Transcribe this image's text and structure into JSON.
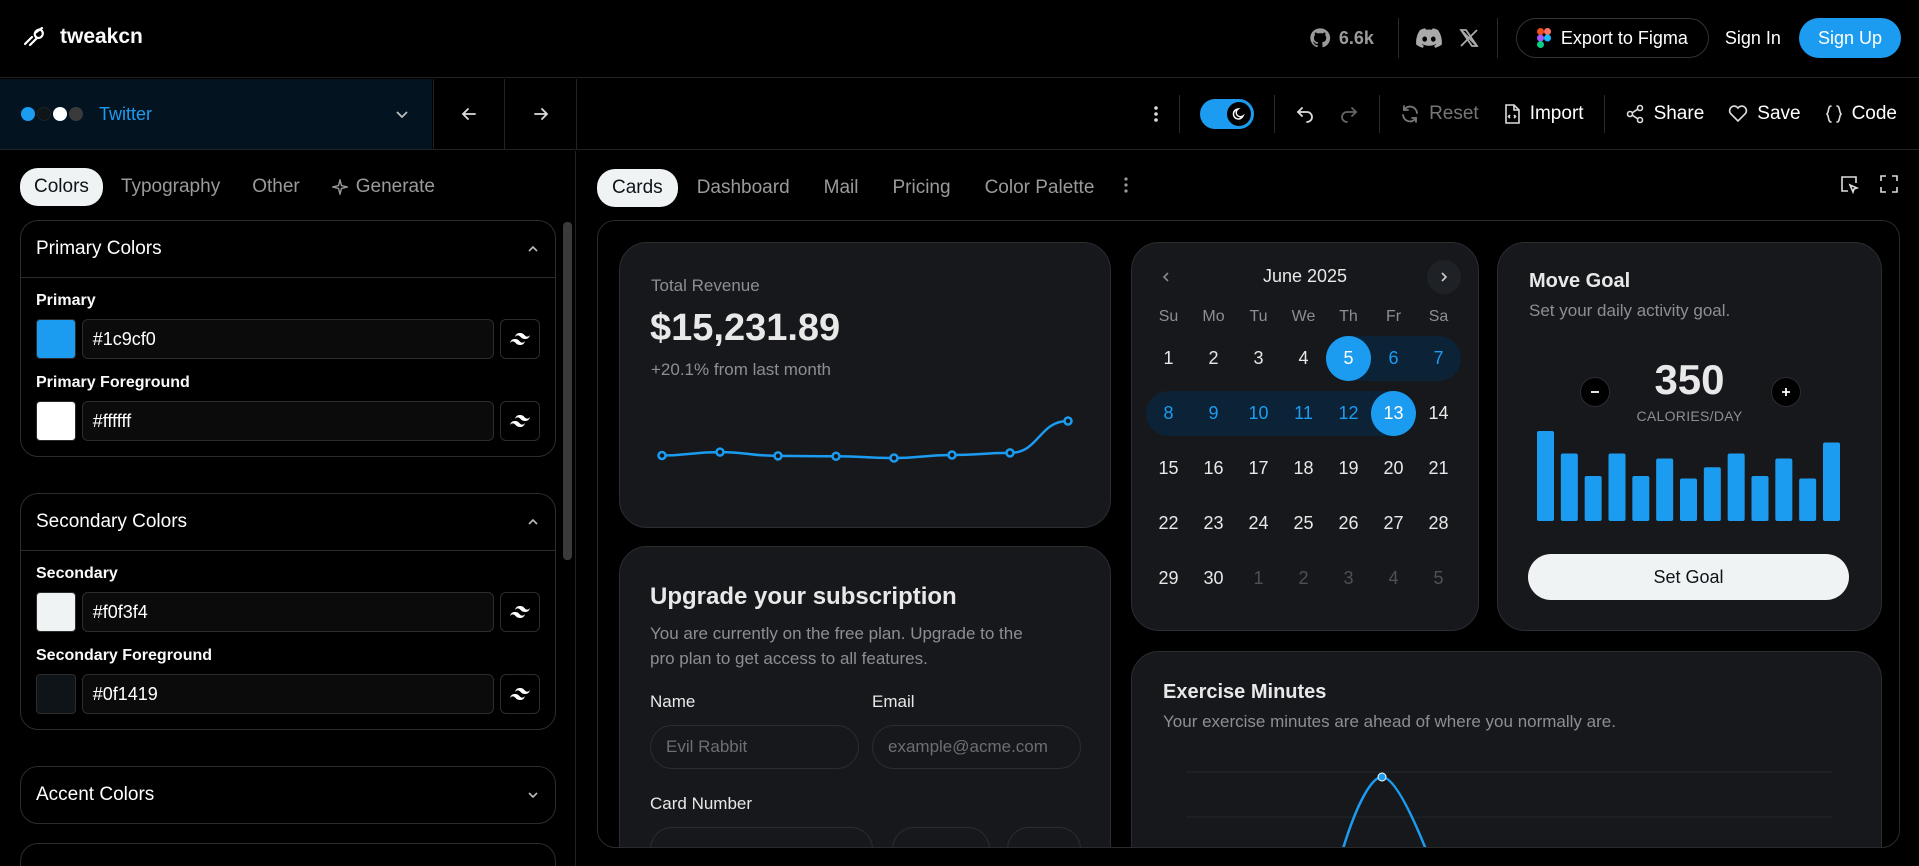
{
  "brand": {
    "name": "tweakcn"
  },
  "top": {
    "github_stars": "6.6k",
    "export_label": "Export to Figma",
    "signin_label": "Sign In",
    "signup_label": "Sign Up"
  },
  "theme": {
    "name": "Twitter",
    "dot_colors": [
      "#1c9cf0",
      "#0f1419",
      "#ffffff",
      "#3a3a3a"
    ]
  },
  "toolbar": {
    "reset_label": "Reset",
    "import_label": "Import",
    "share_label": "Share",
    "save_label": "Save",
    "code_label": "Code",
    "dark_mode": true
  },
  "left_tabs": [
    {
      "label": "Colors",
      "active": true
    },
    {
      "label": "Typography"
    },
    {
      "label": "Other"
    },
    {
      "label": "Generate"
    }
  ],
  "groups": {
    "primary": {
      "title": "Primary Colors",
      "fields": [
        {
          "label": "Primary",
          "value": "#1c9cf0"
        },
        {
          "label": "Primary Foreground",
          "value": "#ffffff"
        }
      ]
    },
    "secondary": {
      "title": "Secondary Colors",
      "fields": [
        {
          "label": "Secondary",
          "value": "#f0f3f4"
        },
        {
          "label": "Secondary Foreground",
          "value": "#0f1419"
        }
      ]
    },
    "accent": {
      "title": "Accent Colors"
    }
  },
  "preview_tabs": [
    "Cards",
    "Dashboard",
    "Mail",
    "Pricing",
    "Color Palette"
  ],
  "revenue": {
    "label": "Total Revenue",
    "value": "$15,231.89",
    "change": "+20.1% from last month",
    "series": [
      10400,
      11200,
      10300,
      10200,
      9800,
      10500,
      11000,
      15231
    ]
  },
  "upgrade": {
    "title": "Upgrade your subscription",
    "description": "You are currently on the free plan. Upgrade to the pro plan to get access to all features.",
    "name_label": "Name",
    "name_placeholder": "Evil Rabbit",
    "email_label": "Email",
    "email_placeholder": "example@acme.com",
    "card_label": "Card Number"
  },
  "calendar": {
    "month": "June 2025",
    "weekdays": [
      "Su",
      "Mo",
      "Tu",
      "We",
      "Th",
      "Fr",
      "Sa"
    ],
    "weeks": [
      [
        "1",
        "2",
        "3",
        "4",
        "5",
        "6",
        "7"
      ],
      [
        "8",
        "9",
        "10",
        "11",
        "12",
        "13",
        "14"
      ],
      [
        "15",
        "16",
        "17",
        "18",
        "19",
        "20",
        "21"
      ],
      [
        "22",
        "23",
        "24",
        "25",
        "26",
        "27",
        "28"
      ],
      [
        "29",
        "30",
        "1",
        "2",
        "3",
        "4",
        "5"
      ]
    ],
    "range_start": "5",
    "range_end": "13"
  },
  "move_goal": {
    "title": "Move Goal",
    "subtitle": "Set your daily activity goal.",
    "value": "350",
    "unit": "CALORIES/DAY",
    "button": "Set Goal",
    "bars": [
      400,
      300,
      200,
      300,
      200,
      278,
      189,
      239,
      300,
      200,
      278,
      189,
      349
    ]
  },
  "exercise": {
    "title": "Exercise Minutes",
    "subtitle": "Your exercise minutes are ahead of where you normally are."
  }
}
